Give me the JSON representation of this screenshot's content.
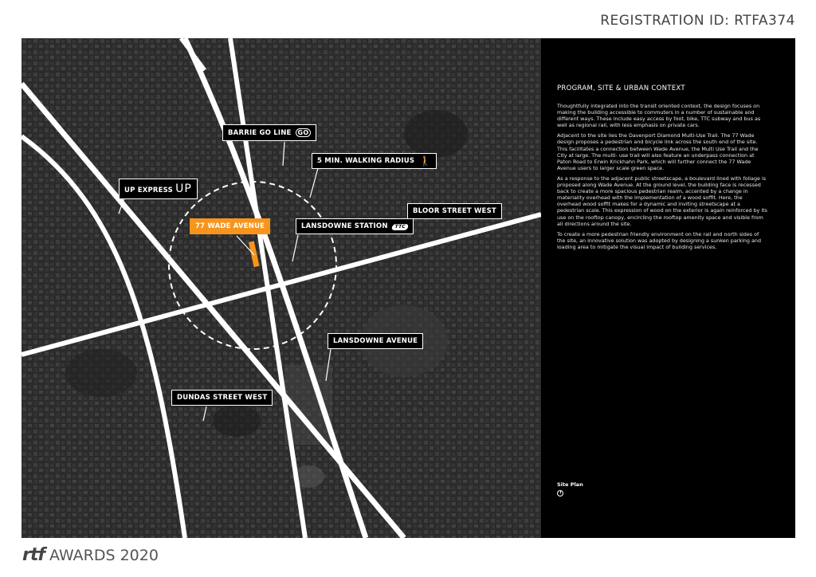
{
  "registration": "REGISTRATION ID: RTFA374",
  "map": {
    "labels": {
      "barrie": "BARRIE GO LINE",
      "barrie_icon": "GO",
      "walking": "5 MIN. WALKING RADIUS",
      "walking_icon": "🚶",
      "up": "UP EXPRESS",
      "up_icon": "UP",
      "wade": "77 WADE AVENUE",
      "station": "LANSDOWNE STATION",
      "station_icon": "TTC",
      "bloor": "BLOOR STREET WEST",
      "lansdowne": "LANSDOWNE AVENUE",
      "dundas": "DUNDAS STREET WEST"
    },
    "colors": {
      "accent": "#f7941d",
      "roads": "#ffffff",
      "background": "#000000"
    }
  },
  "panel": {
    "title": "PROGRAM, SITE & URBAN CONTEXT",
    "p1": "Thoughtfully integrated into the transit oriented context, the design focuses on making the building accessible to commuters in a number of sustainable and different ways. These include easy access by foot, bike, TTC subway and bus as well as regional rail, with less emphasis on private cars.",
    "p2": "Adjacent to the site lies the Davenport Diamond Multi-Use Trail. The 77 Wade design proposes a pedestrian and bicycle link across the south end of the site. This facilitates a connection between Wade Avenue, the Multi Use Trail and the City at large. The multi- use trail will also feature an underpass connection at Paton Road to Erwin Krickhahn Park, which will further connect the 77 Wade Avenue users to larger scale green space.",
    "p3": "As a response to the adjacent public streetscape, a boulevard lined with foliage is proposed along Wade Avenue. At the ground level, the building face is recessed back to create a more spacious pedestrian realm, accented by a change in materiality overhead with the implementation of a wood soffit. Here, the overhead wood soffit makes for a dynamic and inviting streetscape at a pedestrian scale. This expression of wood on the exterior is again reinforced by its use on the rooftop canopy, encircling the rooftop amenity space and visible from all directions around the site.",
    "p4": "To create a more pedestrian friendly environment on the rail and north sides of the site, an innovative solution was adopted by designing a sunken parking and loading area to mitigate the visual impact of building services.",
    "site_plan": "Site Plan"
  },
  "footer": {
    "logo": "rtf",
    "awards": "AWARDS 2020"
  }
}
